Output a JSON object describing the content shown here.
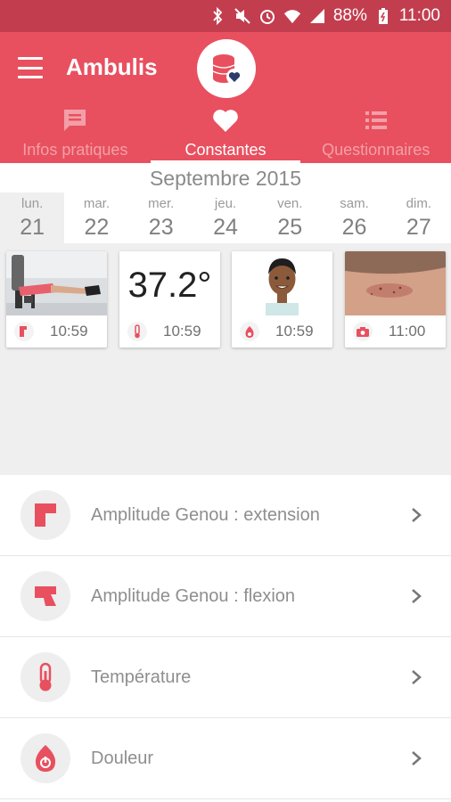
{
  "status_bar": {
    "battery": "88%",
    "time": "11:00"
  },
  "app": {
    "title": "Ambulis"
  },
  "tabs": [
    {
      "label": "Infos pratiques",
      "icon": "message-icon",
      "active": false
    },
    {
      "label": "Constantes",
      "icon": "heart-icon",
      "active": true
    },
    {
      "label": "Questionnaires",
      "icon": "list-icon",
      "active": false
    }
  ],
  "calendar": {
    "month": "Septembre 2015",
    "days": [
      {
        "name": "lun.",
        "num": "21",
        "active": true
      },
      {
        "name": "mar.",
        "num": "22"
      },
      {
        "name": "mer.",
        "num": "23"
      },
      {
        "name": "jeu.",
        "num": "24"
      },
      {
        "name": "ven.",
        "num": "25"
      },
      {
        "name": "sam.",
        "num": "26"
      },
      {
        "name": "dim.",
        "num": "27"
      }
    ]
  },
  "cards": [
    {
      "type": "knee-photo",
      "icon": "knee-icon",
      "time": "10:59"
    },
    {
      "type": "temperature",
      "value": "37.2°",
      "icon": "thermometer-icon",
      "time": "10:59"
    },
    {
      "type": "pain-avatar",
      "icon": "flame-icon",
      "time": "10:59"
    },
    {
      "type": "wound-photo",
      "icon": "camera-icon",
      "time": "11:00"
    }
  ],
  "list": [
    {
      "label": "Amplitude Genou : extension",
      "icon": "knee-extension-icon"
    },
    {
      "label": "Amplitude Genou : flexion",
      "icon": "knee-flexion-icon"
    },
    {
      "label": "Température",
      "icon": "thermometer-icon"
    },
    {
      "label": "Douleur",
      "icon": "flame-icon"
    }
  ],
  "colors": {
    "primary": "#e8505f",
    "status_bar": "#c23e4f",
    "accent_dark": "#2b3b6b"
  }
}
